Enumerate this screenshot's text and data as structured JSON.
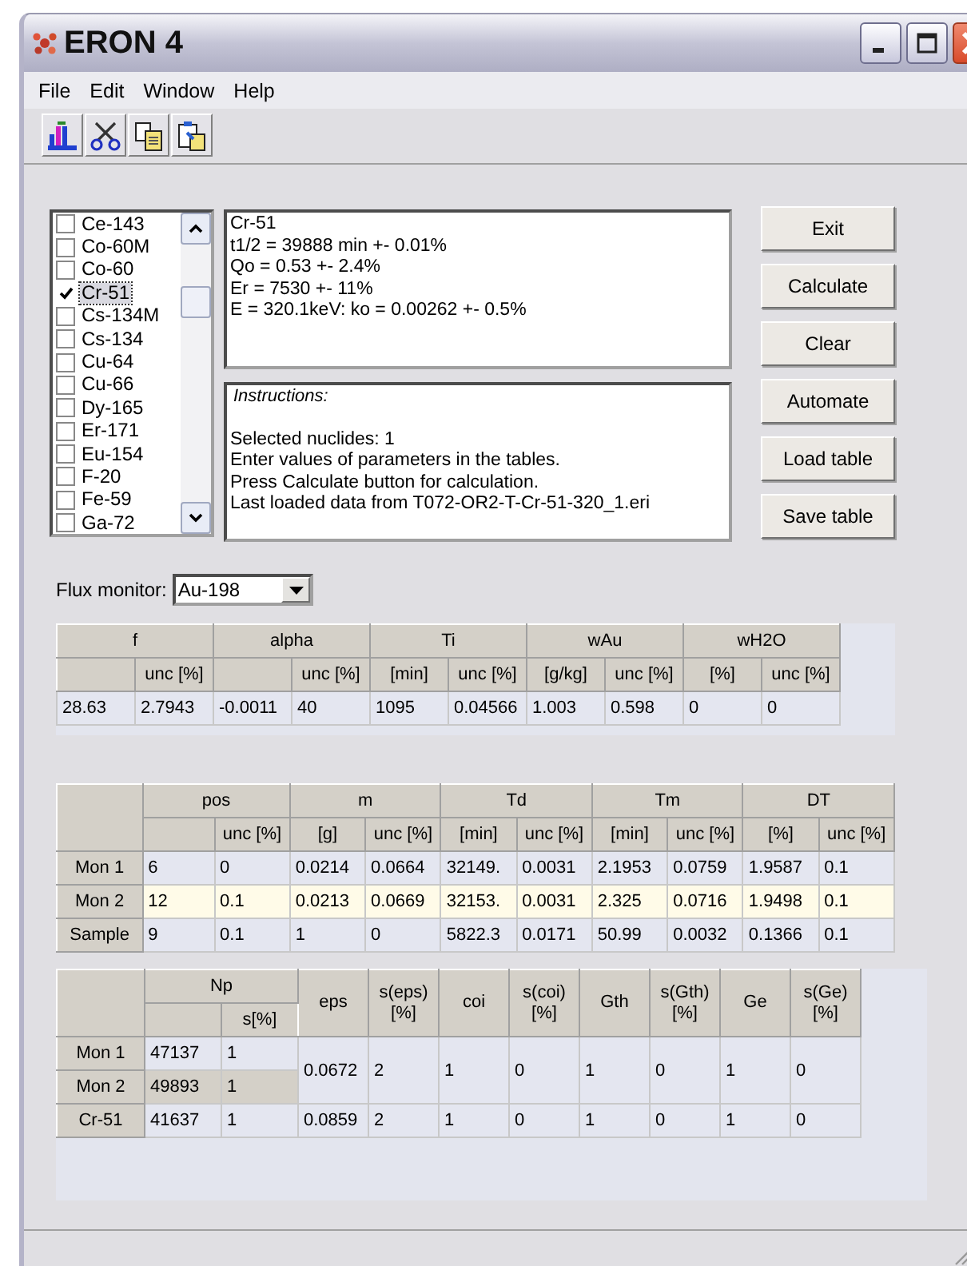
{
  "window": {
    "title": "ERON 4"
  },
  "menu": [
    "File",
    "Edit",
    "Window",
    "Help"
  ],
  "toolbar": [
    {
      "kind": "spectrum"
    },
    {
      "kind": "cut"
    },
    {
      "kind": "copy"
    },
    {
      "kind": "paste"
    }
  ],
  "nuclides": [
    {
      "name": "Ce-143",
      "checked": false,
      "selected": false
    },
    {
      "name": "Co-60M",
      "checked": false,
      "selected": false
    },
    {
      "name": "Co-60",
      "checked": false,
      "selected": false
    },
    {
      "name": "Cr-51",
      "checked": true,
      "selected": true
    },
    {
      "name": "Cs-134M",
      "checked": false,
      "selected": false
    },
    {
      "name": "Cs-134",
      "checked": false,
      "selected": false
    },
    {
      "name": "Cu-64",
      "checked": false,
      "selected": false
    },
    {
      "name": "Cu-66",
      "checked": false,
      "selected": false
    },
    {
      "name": "Dy-165",
      "checked": false,
      "selected": false
    },
    {
      "name": "Er-171",
      "checked": false,
      "selected": false
    },
    {
      "name": "Eu-154",
      "checked": false,
      "selected": false
    },
    {
      "name": "F-20",
      "checked": false,
      "selected": false
    },
    {
      "name": "Fe-59",
      "checked": false,
      "selected": false
    },
    {
      "name": "Ga-72",
      "checked": false,
      "selected": false
    }
  ],
  "nuclide_info": [
    "Cr-51",
    "t1/2 = 39888 min +- 0.01%",
    "Qo = 0.53 +- 2.4%",
    "Er = 7530 +- 11%",
    "E = 320.1keV: ko = 0.00262 +- 0.5%"
  ],
  "instructions": {
    "title": "Instructions:",
    "lines": [
      "Selected nuclides: 1",
      "Enter values of parameters in the tables.",
      "Press Calculate button for calculation.",
      "Last loaded data from T072-OR2-T-Cr-51-320_1.eri"
    ]
  },
  "buttons": [
    "Exit",
    "Calculate",
    "Clear",
    "Automate",
    "Load table",
    "Save table"
  ],
  "flux_monitor": {
    "label": "Flux monitor:",
    "value": "Au-198"
  },
  "table1": {
    "groups": [
      {
        "name": "f",
        "unc_unit": "unc [%]"
      },
      {
        "name": "alpha",
        "unc_unit": "unc [%]"
      },
      {
        "name": "Ti",
        "unit": "[min]",
        "unc_unit": "unc [%]"
      },
      {
        "name": "wAu",
        "unit": "[g/kg]",
        "unc_unit": "unc [%]"
      },
      {
        "name": "wH2O",
        "unit": "[%]",
        "unc_unit": "unc [%]"
      }
    ],
    "rows": [
      [
        "28.63",
        "2.7943",
        "-0.0011",
        "40",
        "1095",
        "0.04566",
        "1.003",
        "0.598",
        "0",
        "0"
      ]
    ]
  },
  "table2": {
    "groups": [
      {
        "name": "pos",
        "unc_unit": "unc [%]"
      },
      {
        "name": "m",
        "unit": "[g]",
        "unc_unit": "unc [%]"
      },
      {
        "name": "Td",
        "unit": "[min]",
        "unc_unit": "unc [%]"
      },
      {
        "name": "Tm",
        "unit": "[min]",
        "unc_unit": "unc [%]"
      },
      {
        "name": "DT",
        "unit": "[%]",
        "unc_unit": "unc [%]"
      }
    ],
    "rows": [
      {
        "label": "Mon 1",
        "selected": false,
        "cells": [
          "6",
          "0",
          "0.0214",
          "0.0664",
          "32149.",
          "0.0031",
          "2.1953",
          "0.0759",
          "1.9587",
          "0.1"
        ]
      },
      {
        "label": "Mon 2",
        "selected": true,
        "cells": [
          "12",
          "0.1",
          "0.0213",
          "0.0669",
          "32153.",
          "0.0031",
          "2.325",
          "0.0716",
          "1.9498",
          "0.1"
        ]
      },
      {
        "label": "Sample",
        "selected": false,
        "cells": [
          "9",
          "0.1",
          "1",
          "0",
          "5822.3",
          "0.0171",
          "50.99",
          "0.0032",
          "0.1366",
          "0.1"
        ]
      }
    ]
  },
  "table3": {
    "np_header": "Np",
    "np_unc_unit": "s[%]",
    "columns": [
      "eps",
      "s(eps) [%]",
      "coi",
      "s(coi) [%]",
      "Gth",
      "s(Gth) [%]",
      "Ge",
      "s(Ge) [%]"
    ],
    "row_groups": [
      {
        "rows": [
          {
            "label": "Mon 1",
            "selected": false,
            "np": [
              "47137",
              "1"
            ]
          },
          {
            "label": "Mon 2",
            "selected": true,
            "np": [
              "49893",
              "1"
            ]
          }
        ],
        "values": [
          "0.0672",
          "2",
          "1",
          "0",
          "1",
          "0",
          "1",
          "0"
        ]
      },
      {
        "rows": [
          {
            "label": "Cr-51",
            "selected": false,
            "np": [
              "41637",
              "1"
            ]
          }
        ],
        "values": [
          "0.0859",
          "2",
          "1",
          "0",
          "1",
          "0",
          "1",
          "0"
        ]
      }
    ]
  }
}
